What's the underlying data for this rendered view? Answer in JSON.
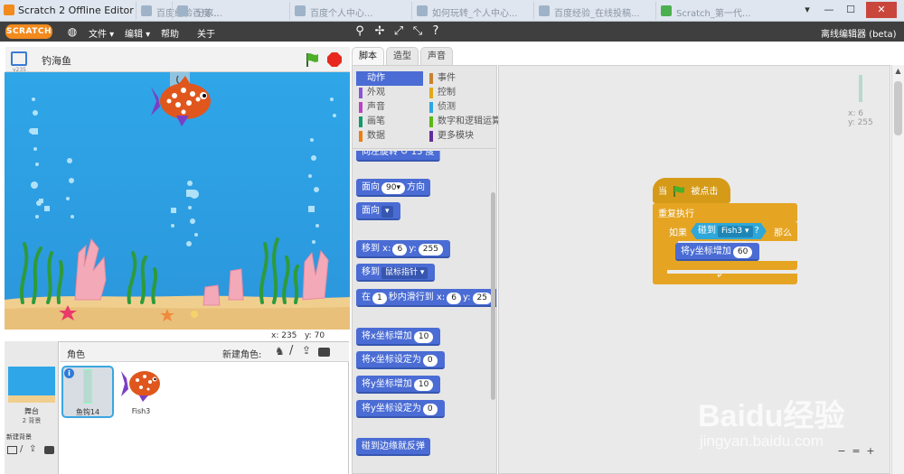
{
  "window": {
    "title": "Scratch 2 Offline Editor",
    "tabs": [
      "百度经验-分享...",
      "百度...",
      "百度个人中心...",
      "如何玩转_个人中心...",
      "百度经验_在线投稿...",
      "Scratch_第一代..."
    ],
    "controls": [
      "▾",
      "—",
      "☐",
      "✕"
    ]
  },
  "menubar": {
    "logo": "SCRATCH",
    "items": [
      "文件 ▾",
      "编辑 ▾",
      "帮助",
      "关于"
    ],
    "offline_label": "离线编辑器 (beta)"
  },
  "stage": {
    "project_title": "钓海鱼",
    "version": "v235",
    "coords": {
      "x_label": "x:",
      "x": "235",
      "y_label": "y:",
      "y": "70"
    }
  },
  "sprites": {
    "header": "角色",
    "new_sprite_label": "新建角色:",
    "stage_label": "舞台",
    "backdrops": "2 背景",
    "new_backdrop_label": "新建背景",
    "items": [
      {
        "name": "鱼钩14",
        "selected": true
      },
      {
        "name": "Fish3",
        "selected": false
      }
    ]
  },
  "tabs": [
    "脚本",
    "造型",
    "声音"
  ],
  "categories": [
    {
      "label": "动作",
      "color": "#4a6cd4",
      "selected": true
    },
    {
      "label": "外观",
      "color": "#8a55d7"
    },
    {
      "label": "声音",
      "color": "#bb42c3"
    },
    {
      "label": "画笔",
      "color": "#0e9a6c"
    },
    {
      "label": "数据",
      "color": "#ee7d16"
    },
    {
      "label": "事件",
      "color": "#c88330"
    },
    {
      "label": "控制",
      "color": "#e1a91a"
    },
    {
      "label": "侦测",
      "color": "#2ca5e2"
    },
    {
      "label": "数字和逻辑运算",
      "color": "#5cb712"
    },
    {
      "label": "更多模块",
      "color": "#632d99"
    }
  ],
  "palette_blocks": {
    "turn_partial": "向左旋转 ↺ 15 度",
    "point_dir": {
      "text": "面向",
      "value": "90▾",
      "suffix": "方向"
    },
    "point_towards": {
      "text": "面向",
      "value": "▾"
    },
    "goto_xy": {
      "text": "移到 x:",
      "x": "6",
      "ylabel": "y:",
      "y": "255"
    },
    "goto_target": {
      "text": "移到",
      "value": "鼠标指针 ▾"
    },
    "glide": {
      "pre": "在",
      "secs": "1",
      "mid": "秒内滑行到 x:",
      "x": "6",
      "ylabel": "y:",
      "y": "25"
    },
    "change_x": {
      "text": "将x坐标增加",
      "value": "10"
    },
    "set_x": {
      "text": "将x坐标设定为",
      "value": "0"
    },
    "change_y": {
      "text": "将y坐标增加",
      "value": "10"
    },
    "set_y": {
      "text": "将y坐标设定为",
      "value": "0"
    },
    "bounce": "碰到边缘就反弹"
  },
  "script": {
    "hat": {
      "pre": "当",
      "post": "被点击"
    },
    "forever": "重复执行",
    "if": {
      "pre": "如果",
      "then": "那么"
    },
    "touching": {
      "text": "碰到",
      "target": "Fish3 ▾",
      "q": "?"
    },
    "change_y": {
      "text": "将y坐标增加",
      "value": "60"
    },
    "sprite_info": {
      "x": "x: 6",
      "y": "y: 255"
    }
  },
  "watermark": {
    "brand": "Baidu经验",
    "url": "jingyan.baidu.com"
  },
  "zoom": {
    "out": "−",
    "reset": "=",
    "in": "+"
  }
}
